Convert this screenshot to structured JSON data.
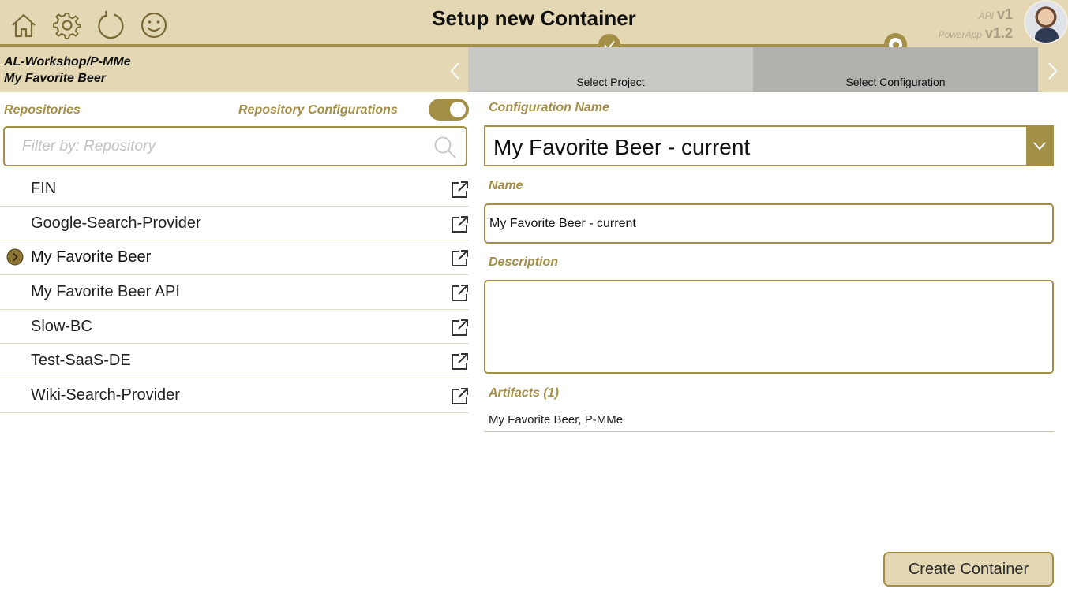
{
  "header": {
    "title": "Setup new Container",
    "api_key": "API",
    "api_version": "v1",
    "powerapp_key": "PowerApp",
    "powerapp_version": "v1.2",
    "icons": [
      "home-icon",
      "gear-icon",
      "refresh-icon",
      "smiley-icon"
    ],
    "project_path": "AL-Workshop/P-MMe",
    "project_name": "My Favorite Beer",
    "steps": [
      {
        "label": "Select Project",
        "state": "done"
      },
      {
        "label": "Select Configuration",
        "state": "current"
      }
    ]
  },
  "left": {
    "repositories_label": "Repositories",
    "repo_configs_label": "Repository Configurations",
    "repo_configs_toggle": true,
    "filter_placeholder": "Filter by: Repository",
    "repositories": [
      {
        "name": "FIN",
        "selected": false
      },
      {
        "name": "Google-Search-Provider",
        "selected": false
      },
      {
        "name": "My Favorite Beer",
        "selected": true
      },
      {
        "name": "My Favorite Beer API",
        "selected": false
      },
      {
        "name": "Slow-BC",
        "selected": false
      },
      {
        "name": "Test-SaaS-DE",
        "selected": false
      },
      {
        "name": "Wiki-Search-Provider",
        "selected": false
      }
    ]
  },
  "right": {
    "config_name_label": "Configuration Name",
    "config_name_value": "My Favorite Beer - current",
    "name_label": "Name",
    "name_value": "My Favorite Beer - current",
    "description_label": "Description",
    "description_value": "",
    "artifacts_label": "Artifacts (1)",
    "artifacts_value": "My Favorite Beer, P-MMe",
    "create_button": "Create Container"
  },
  "colors": {
    "accent": "#a48f46",
    "header_bg": "#e3d7b4",
    "tab_inactive": "#c8c8c4",
    "tab_active": "#b1b1ad"
  }
}
